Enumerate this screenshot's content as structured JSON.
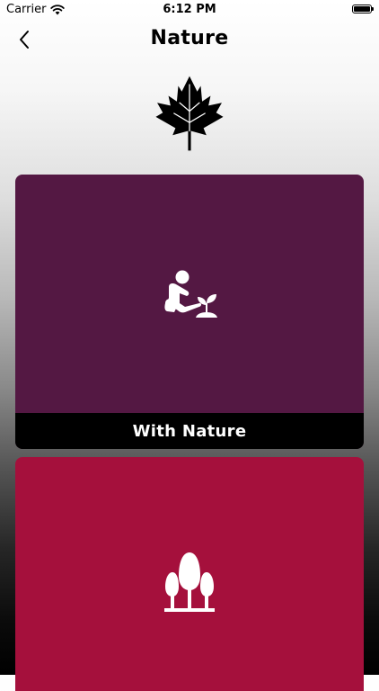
{
  "status_bar": {
    "carrier": "Carrier",
    "time": "6:12 PM",
    "battery_level": 1.0
  },
  "nav": {
    "title": "Nature",
    "back_icon": "chevron-left-icon"
  },
  "header_icon": "maple-leaf-icon",
  "cards": [
    {
      "label": "With Nature",
      "icon": "gardening-person-icon",
      "color": "#541843"
    },
    {
      "label": "",
      "icon": "trees-icon",
      "color": "#a5103c"
    }
  ],
  "colors": {
    "label_bar": "#000000",
    "label_text": "#ffffff"
  }
}
